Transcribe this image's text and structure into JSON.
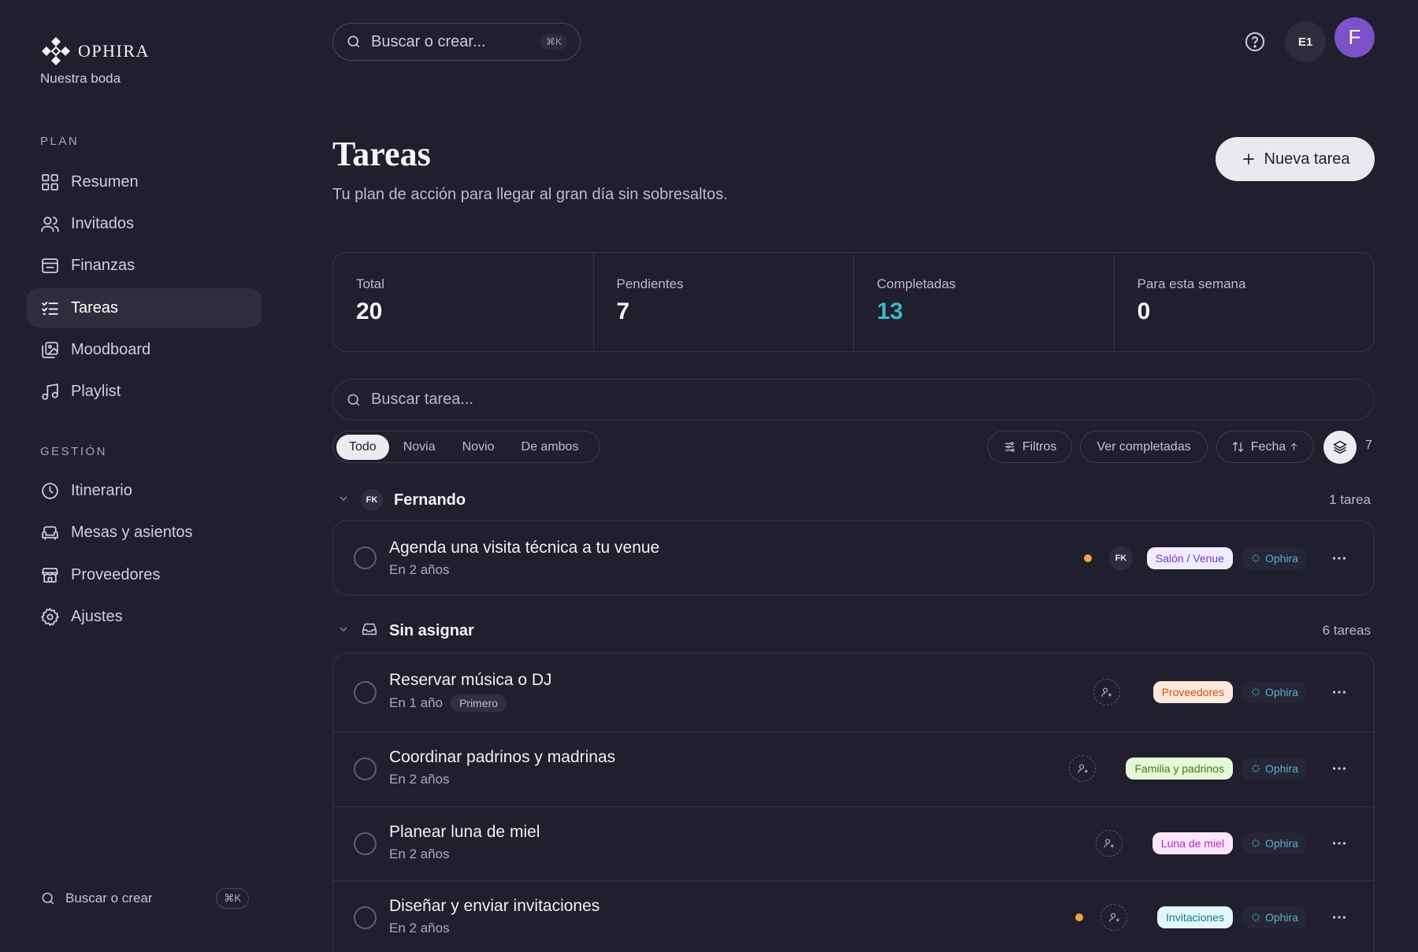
{
  "brand": {
    "name": "OPHIRA",
    "subtitle": "Nuestra boda"
  },
  "sidebar": {
    "plan_label": "PLAN",
    "gestion_label": "GESTIÓN",
    "plan_items": [
      {
        "label": "Resumen",
        "icon": "grid-icon"
      },
      {
        "label": "Invitados",
        "icon": "users-icon"
      },
      {
        "label": "Finanzas",
        "icon": "wallet-icon"
      },
      {
        "label": "Tareas",
        "icon": "checklist-icon",
        "active": true
      },
      {
        "label": "Moodboard",
        "icon": "images-icon"
      },
      {
        "label": "Playlist",
        "icon": "music-icon"
      }
    ],
    "gestion_items": [
      {
        "label": "Itinerario",
        "icon": "clock-icon"
      },
      {
        "label": "Mesas y asientos",
        "icon": "sofa-icon"
      },
      {
        "label": "Proveedores",
        "icon": "store-icon"
      },
      {
        "label": "Ajustes",
        "icon": "gear-icon"
      }
    ],
    "search_label": "Buscar o crear",
    "search_kbd": "⌘K"
  },
  "topbar": {
    "search_placeholder": "Buscar o crear...",
    "search_kbd": "⌘K",
    "workspace_badge": "E1",
    "avatar_initial": "F"
  },
  "header": {
    "title": "Tareas",
    "subtitle": "Tu plan de acción para llegar al gran día sin sobresaltos.",
    "new_task_label": "Nueva tarea"
  },
  "stats": [
    {
      "label": "Total",
      "value": "20"
    },
    {
      "label": "Pendientes",
      "value": "7"
    },
    {
      "label": "Completadas",
      "value": "13"
    },
    {
      "label": "Para esta semana",
      "value": "0"
    }
  ],
  "task_search_placeholder": "Buscar tarea...",
  "filters": {
    "segments": [
      "Todo",
      "Novia",
      "Novio",
      "De ambos"
    ],
    "active_segment": "Todo",
    "filters_label": "Filtros",
    "show_completed_label": "Ver completadas",
    "sort_label": "Fecha",
    "group_count": "7"
  },
  "groups": [
    {
      "name": "Fernando",
      "badge": "FK",
      "count_label": "1 tarea",
      "tasks": [
        {
          "title": "Agenda una visita técnica a tu venue",
          "due": "En 2 años",
          "priority_dot": true,
          "assignee": "FK",
          "category": "Salón / Venue",
          "source": "Ophira"
        }
      ]
    },
    {
      "name": "Sin asignar",
      "count_label": "6 tareas",
      "tasks": [
        {
          "title": "Reservar música o DJ",
          "due": "En 1 año",
          "badge": "Primero",
          "priority_dot": false,
          "category": "Proveedores",
          "source": "Ophira"
        },
        {
          "title": "Coordinar padrinos y madrinas",
          "due": "En 2 años",
          "priority_dot": false,
          "category": "Familia y padrinos",
          "source": "Ophira"
        },
        {
          "title": "Planear luna de miel",
          "due": "En 2 años",
          "priority_dot": false,
          "category": "Luna de miel",
          "source": "Ophira"
        },
        {
          "title": "Diseñar y enviar invitaciones",
          "due": "En 2 años",
          "priority_dot": true,
          "category": "Invitaciones",
          "source": "Ophira"
        }
      ]
    }
  ],
  "colors": {
    "background": "#1f1f2d",
    "accent_teal": "#3fb5c4",
    "avatar_purple": "#7b52c9",
    "priority_orange": "#f0a43c"
  }
}
